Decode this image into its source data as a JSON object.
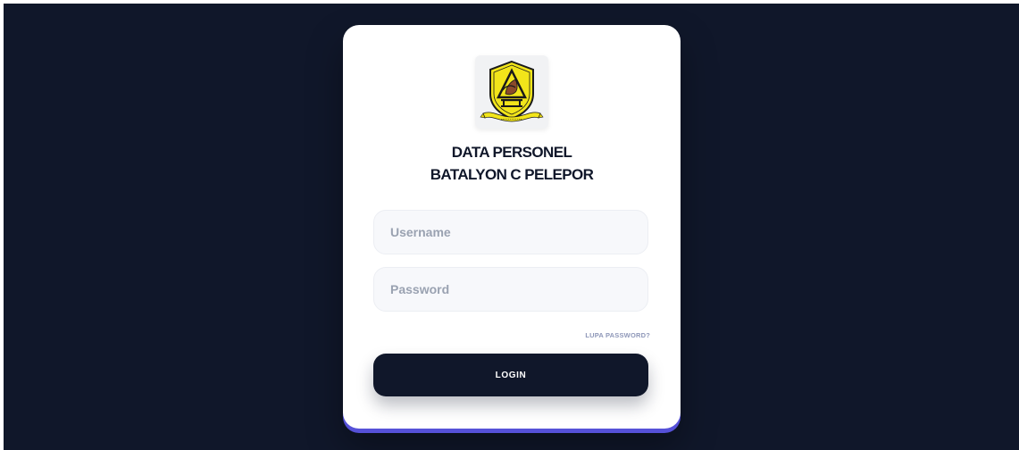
{
  "app": {
    "title_line1": "DATA PERSONEL",
    "title_line2": "BATALYON C PELEPOR"
  },
  "logo": {
    "icon": "shield-emblem-icon",
    "colors": {
      "shield": "#f2e51a",
      "outline": "#1a1a1a",
      "emblem": "#8b4a2b"
    }
  },
  "form": {
    "username_placeholder": "Username",
    "username_value": "",
    "password_placeholder": "Password",
    "password_value": "",
    "forgot_label": "LUPA PASSWORD?",
    "login_label": "LOGIN"
  },
  "colors": {
    "background": "#10172a",
    "card": "#ffffff",
    "accent": "#5651d8",
    "button": "#10172a",
    "muted_link": "#8e97b8"
  }
}
